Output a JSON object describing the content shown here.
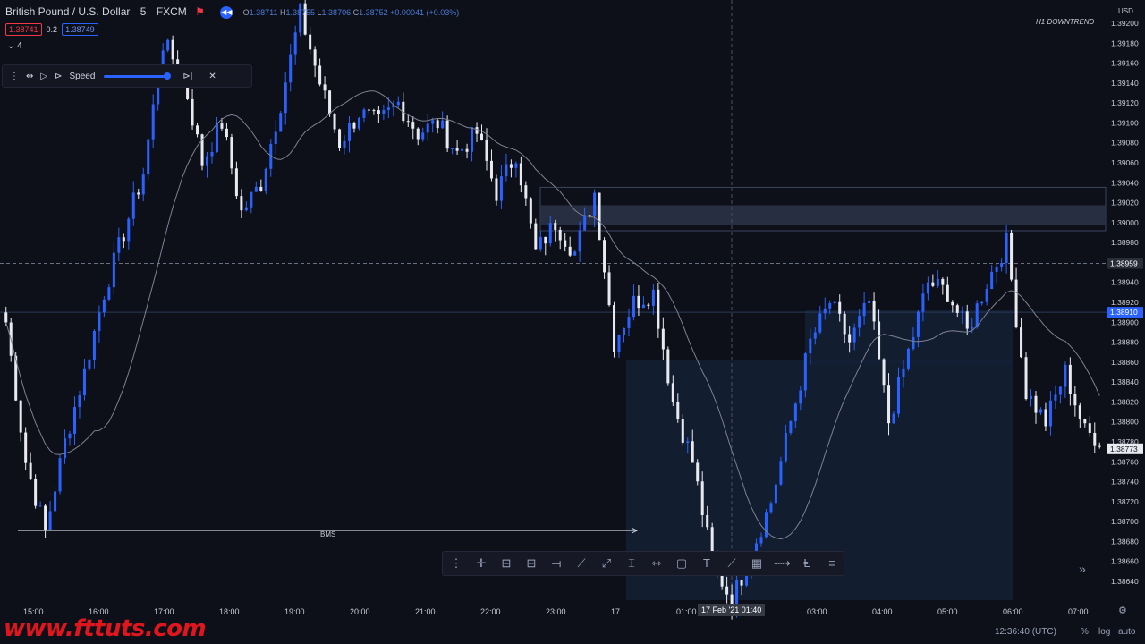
{
  "header": {
    "symbol": "British Pound / U.S. Dollar",
    "timeframe": "5",
    "broker": "FXCM",
    "ohlc": {
      "o_label": "O",
      "o": "1.38711",
      "h_label": "H",
      "h": "1.38755",
      "l_label": "L",
      "l": "1.38706",
      "c_label": "C",
      "c": "1.38752",
      "change": "+0.00041 (+0.03%)"
    },
    "bid": "1.38741",
    "spread": "0.2",
    "ask": "1.38749",
    "indicator_count": "4"
  },
  "replay": {
    "speed_label": "Speed"
  },
  "annotations": {
    "h1_label": "H1 DOWNTREND",
    "bms_label": "BMS"
  },
  "price_axis": {
    "currency": "USD",
    "crosshair_price": "1.38959",
    "marker_blue": "1.38910",
    "marker_last": "1.38773"
  },
  "crosshair_time": "17 Feb '21   01:40",
  "bottom_bar": {
    "clock": "12:36:40 (UTC)",
    "percent": "%",
    "log": "log",
    "auto": "auto"
  },
  "watermark": "www.fttuts.com",
  "colors": {
    "up": "#2962ff",
    "down": "#e8eaf0",
    "ma": "#7d8191",
    "zone": "#3a4a6a",
    "bg": "#0e1019"
  },
  "chart_data": {
    "type": "candlestick",
    "title": "British Pound / U.S. Dollar",
    "ylim": [
      1.3862,
      1.3924
    ],
    "y_ticks": [
      "1.39200",
      "1.39180",
      "1.39160",
      "1.39140",
      "1.39120",
      "1.39100",
      "1.39080",
      "1.39060",
      "1.39040",
      "1.39020",
      "1.39000",
      "1.38980",
      "1.38960",
      "1.38940",
      "1.38920",
      "1.38900",
      "1.38880",
      "1.38860",
      "1.38840",
      "1.38820",
      "1.38800",
      "1.38780",
      "1.38760",
      "1.38740",
      "1.38720",
      "1.38700",
      "1.38680",
      "1.38660",
      "1.38640"
    ],
    "x_ticks": [
      "15:00",
      "16:00",
      "17:00",
      "18:00",
      "19:00",
      "20:00",
      "21:00",
      "22:00",
      "23:00",
      "17",
      "01:00",
      "03:00",
      "04:00",
      "05:00",
      "06:00",
      "07:00"
    ],
    "supply_zone": [
      1.3899,
      1.3903
    ],
    "bms_level": 1.38691,
    "crosshair_price": 1.38959,
    "path": [
      1.389,
      1.3876,
      1.3869,
      1.3878,
      1.3885,
      1.3893,
      1.3899,
      1.3905,
      1.3918,
      1.3915,
      1.3906,
      1.391,
      1.3901,
      1.3904,
      1.3912,
      1.3921,
      1.3914,
      1.3908,
      1.3911,
      1.391,
      1.3912,
      1.3909,
      1.391,
      1.3907,
      1.3909,
      1.3903,
      1.3907,
      1.3897,
      1.39,
      1.3897,
      1.3903,
      1.3888,
      1.3892,
      1.3893,
      1.3882,
      1.3876,
      1.3866,
      1.3862,
      1.3867,
      1.3872,
      1.388,
      1.3888,
      1.3892,
      1.3888,
      1.3892,
      1.388,
      1.3887,
      1.3894,
      1.3893,
      1.3889,
      1.3894,
      1.3898,
      1.3883,
      1.388,
      1.3885,
      1.3879,
      1.3878
    ]
  }
}
